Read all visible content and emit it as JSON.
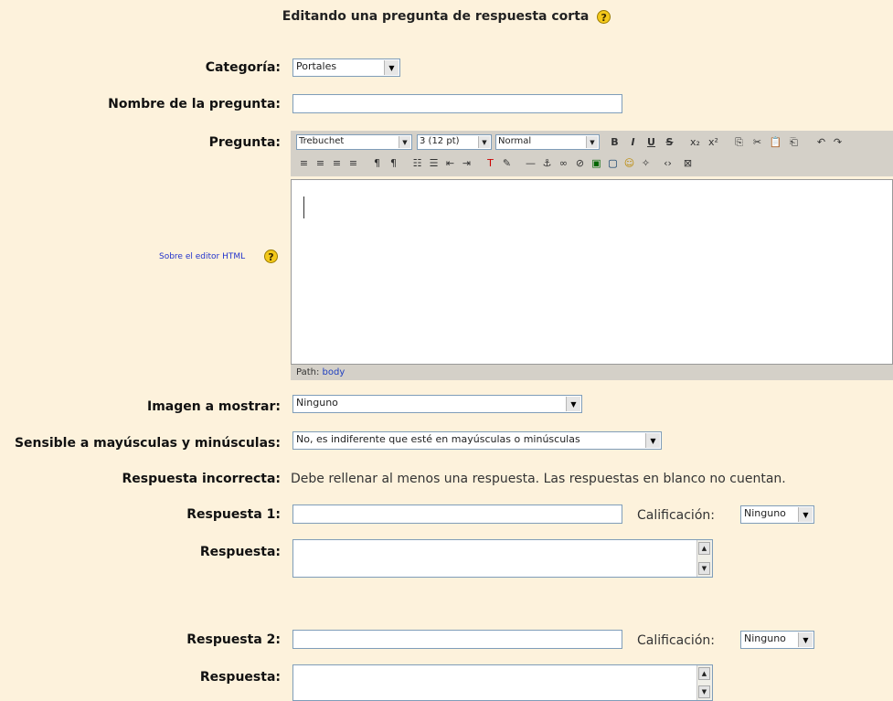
{
  "header": {
    "title": "Editando una pregunta de respuesta corta"
  },
  "icons": {
    "help": "help-question-icon",
    "help_symbol": "?"
  },
  "form": {
    "categoria": {
      "label": "Categoría:",
      "value": "Portales"
    },
    "nombre": {
      "label": "Nombre de la pregunta:",
      "value": ""
    },
    "pregunta": {
      "label": "Pregunta:",
      "editor_link": "Sobre el editor HTML",
      "font_family": "Trebuchet",
      "font_size": "3 (12 pt)",
      "format": "Normal",
      "path_label": "Path:",
      "path_value": "body"
    },
    "imagen": {
      "label": "Imagen a mostrar:",
      "value": "Ninguno"
    },
    "sensible": {
      "label": "Sensible a mayúsculas y minúsculas:",
      "value": "No, es indiferente que esté en mayúsculas o minúsculas"
    },
    "error": {
      "label": "Respuesta incorrecta:",
      "message": "Debe rellenar al menos una respuesta. Las respuestas en blanco no cuentan."
    },
    "respuestas": [
      {
        "label": "Respuesta 1:",
        "value": "",
        "grade_label": "Calificación:",
        "grade": "Ninguno",
        "feedback_label": "Respuesta:"
      },
      {
        "label": "Respuesta 2:",
        "value": "",
        "grade_label": "Calificación:",
        "grade": "Ninguno",
        "feedback_label": "Respuesta:"
      }
    ]
  },
  "toolbar": {
    "row1": [
      "B",
      "I",
      "U",
      "S",
      "x₂",
      "x²",
      "⎘",
      "✂",
      "📋",
      "⎗",
      "↶",
      "↷"
    ],
    "row2": [
      "≡",
      "≡",
      "≡",
      "≡",
      "¶",
      "¶",
      "☷",
      "☰",
      "⇤",
      "⇥",
      "T",
      "✎",
      "—",
      "⚓",
      "∞",
      "⊘",
      "▣",
      "▢",
      "☺",
      "✧",
      "‹›",
      "⊠"
    ]
  },
  "colors": {
    "background": "#fdf2dc",
    "label": "#111111",
    "link": "#2233cc",
    "toolbar": "#d4d0c8"
  }
}
